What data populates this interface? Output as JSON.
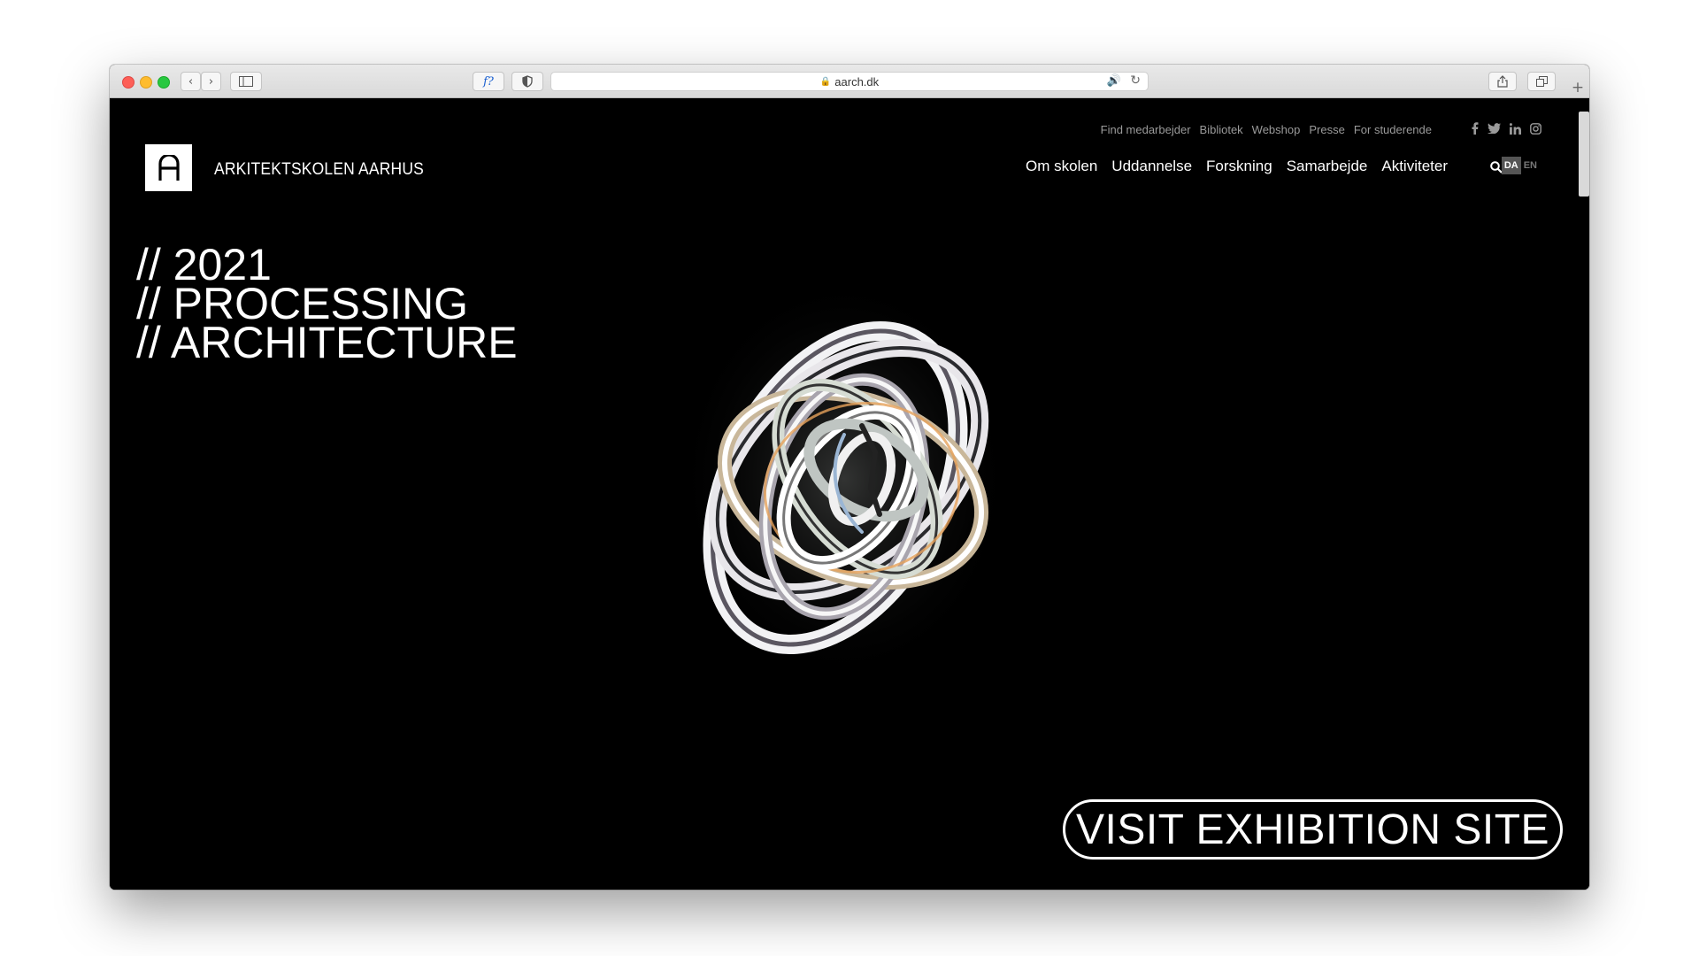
{
  "browser": {
    "url": "aarch.dk",
    "reader_label": "f?",
    "icons": [
      "back-icon",
      "forward-icon",
      "sidebar-icon",
      "privacy-shield-icon",
      "lock-icon",
      "speaker-icon",
      "reload-icon",
      "share-icon",
      "tabs-icon",
      "new-tab-icon"
    ]
  },
  "site": {
    "brand": "ARKITEKTSKOLEN AARHUS",
    "util_nav": [
      "Find medarbejder",
      "Bibliotek",
      "Webshop",
      "Presse",
      "For studerende"
    ],
    "social": [
      "facebook-icon",
      "twitter-icon",
      "linkedin-icon",
      "instagram-icon"
    ],
    "main_nav": [
      "Om skolen",
      "Uddannelse",
      "Forskning",
      "Samarbejde",
      "Aktiviteter"
    ],
    "lang": {
      "da": "DA",
      "en": "EN",
      "active": "DA"
    },
    "headline": [
      "// 2021",
      "// PROCESSING",
      "// ARCHITECTURE"
    ],
    "cta": "VISIT EXHIBITION SITE",
    "colors": {
      "background": "#000000",
      "text": "#ffffff",
      "muted": "#9a9a9a"
    }
  }
}
